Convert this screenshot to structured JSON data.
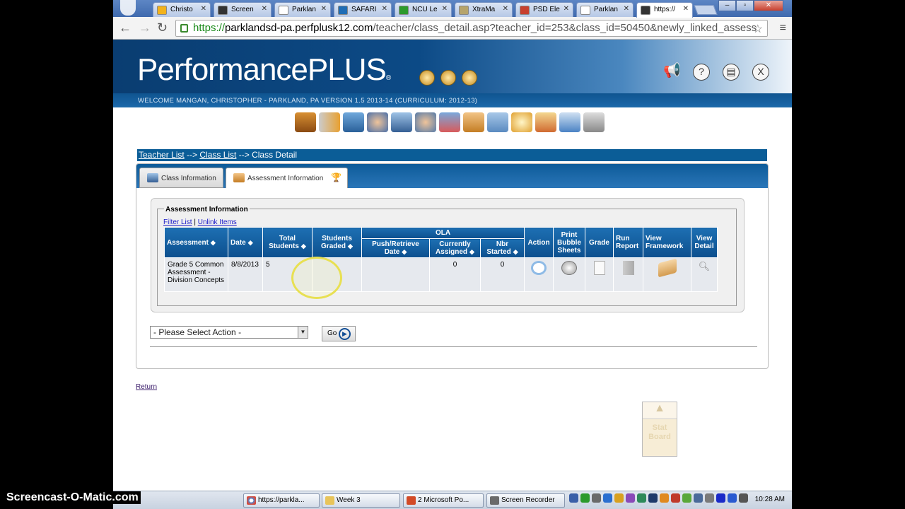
{
  "browser": {
    "tabs": [
      {
        "label": "Christo",
        "icon": "outlook-icon",
        "color": "#f2b21b"
      },
      {
        "label": "Screen",
        "icon": "som-icon",
        "color": "#333333"
      },
      {
        "label": "Parklan",
        "icon": "page-icon",
        "color": "#ffffff"
      },
      {
        "label": "SAFARI",
        "icon": "safari-m-icon",
        "color": "#1f6db5"
      },
      {
        "label": "NCU Le",
        "icon": "ncu-l-icon",
        "color": "#2c9a2c"
      },
      {
        "label": "XtraMa",
        "icon": "xtramath-icon",
        "color": "#b6a46c"
      },
      {
        "label": "PSD Ele",
        "icon": "psd-icon",
        "color": "#c7402e"
      },
      {
        "label": "Parklan",
        "icon": "page-icon",
        "color": "#ffffff"
      },
      {
        "label": "https://",
        "icon": "globe-icon",
        "color": "#333333"
      }
    ],
    "url_scheme": "https://",
    "url_host": "parklandsd-pa.perfplusk12.com",
    "url_path": "/teacher/class_detail.asp?teacher_id=253&class_id=50450&newly_linked_assess"
  },
  "header": {
    "logo": "PerformancePLUS",
    "welcome": "WELCOME  MANGAN, CHRISTOPHER - PARKLAND, PA VERSION 1.5  2013-14 (CURRICULUM: 2012-13)"
  },
  "breadcrumb": {
    "teacher_list": "Teacher List",
    "sep1": " --> ",
    "class_list": "Class List",
    "sep2": " --> ",
    "current": "Class Detail"
  },
  "tabs": {
    "class_info": "Class Information",
    "assessment_info": "Assessment Information"
  },
  "assessment": {
    "legend": "Assessment Information",
    "filter_link": "Filter List",
    "link_sep": " | ",
    "unlink_link": "Unlink Items",
    "headers": {
      "assessment": "Assessment",
      "date": "Date",
      "total_students": "Total Students",
      "students_graded": "Students Graded",
      "ola": "OLA",
      "push_retrieve": "Push/Retrieve Date",
      "currently_assigned": "Currently Assigned",
      "nbr_started": "Nbr Started",
      "action": "Action",
      "print_bubble": "Print Bubble Sheets",
      "grade": "Grade",
      "run_report": "Run Report",
      "view_framework": "View Framework",
      "view_detail": "View Detail"
    },
    "rows": [
      {
        "assessment": "Grade 5 Common Assessment - Division Concepts",
        "date": "8/8/2013",
        "total_students": "5",
        "students_graded": "",
        "push_retrieve": "",
        "currently_assigned": "0",
        "nbr_started": "0"
      }
    ]
  },
  "action_select": {
    "selected": "- Please Select Action -"
  },
  "go_button": "Go",
  "return_link": "Return",
  "stat_board": "Stat Board",
  "taskbar": {
    "watermark": "Screencast-O-Matic.com",
    "items": [
      {
        "label": "https://parkla...",
        "icon": "chrome-icon"
      },
      {
        "label": "Week 3",
        "icon": "folder-icon"
      },
      {
        "label": "2 Microsoft Po...",
        "icon": "powerpoint-icon"
      },
      {
        "label": "Screen Recorder",
        "icon": "recorder-icon"
      }
    ],
    "clock": "10:28 AM"
  }
}
